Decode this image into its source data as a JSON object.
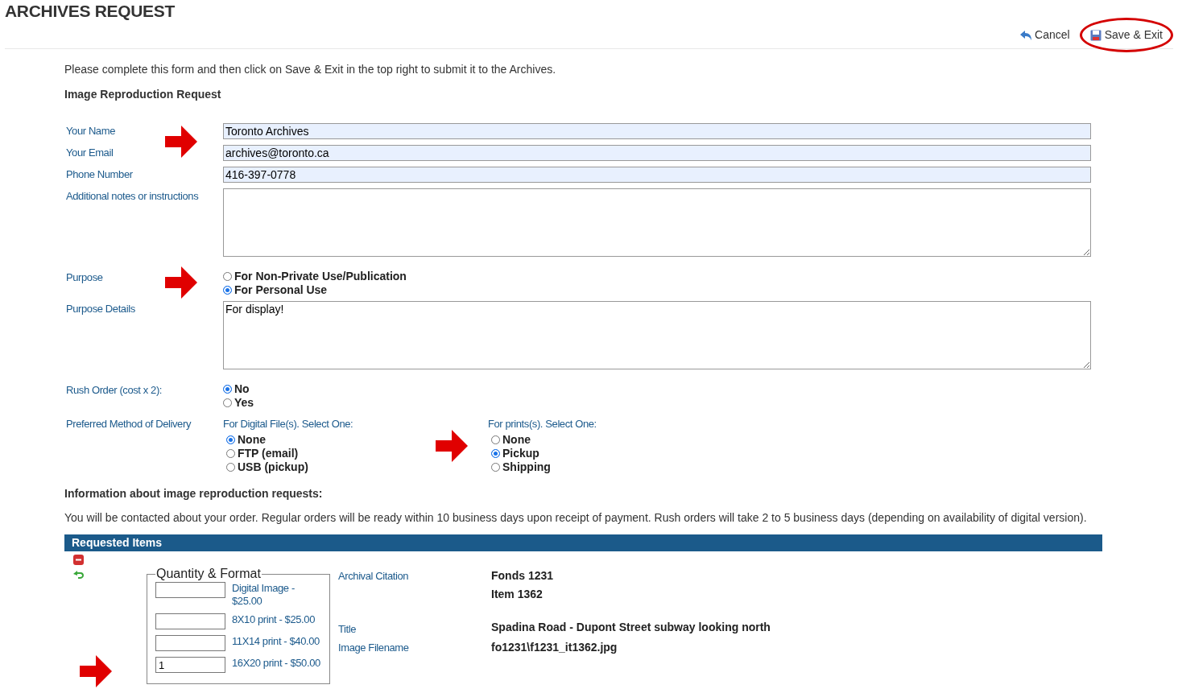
{
  "title": "ARCHIVES REQUEST",
  "toolbar": [
    {
      "kind": "cancel",
      "label": "Cancel",
      "circled": false
    },
    {
      "kind": "save",
      "label": "Save & Exit",
      "circled": true
    }
  ],
  "intro": "Please complete this form and then click on Save & Exit in the top right to submit it to the Archives.",
  "section_title": "Image Reproduction Request",
  "fields": [
    {
      "kind": "text",
      "label": "Your Name",
      "value": "Toronto Archives",
      "arrow": true
    },
    {
      "kind": "text",
      "label": "Your Email",
      "value": "archives@toronto.ca",
      "arrow": false
    },
    {
      "kind": "text",
      "label": "Phone Number",
      "value": "416-397-0778",
      "arrow": false
    },
    {
      "kind": "textarea",
      "label": "Additional notes or instructions",
      "arrow": false
    },
    {
      "kind": "radio",
      "label": "Purpose",
      "arrow": true,
      "options": [
        {
          "label": "For Non-Private Use/Publication",
          "selected": false
        },
        {
          "label": "For Personal Use",
          "selected": true
        }
      ]
    },
    {
      "kind": "textarea",
      "label": "Purpose Details",
      "value": "For display!",
      "arrow": false
    },
    {
      "kind": "radio",
      "label": "Rush Order (cost x 2):",
      "arrow": false,
      "options": [
        {
          "label": "No",
          "selected": true
        },
        {
          "label": "Yes",
          "selected": false
        }
      ]
    },
    {
      "kind": "delivery",
      "label": "Preferred Method of Delivery",
      "arrow": false,
      "groups": [
        {
          "title": "For Digital File(s). Select One:",
          "arrow": false,
          "options": [
            {
              "label": "None",
              "selected": true
            },
            {
              "label": "FTP (email)",
              "selected": false
            },
            {
              "label": "USB (pickup)",
              "selected": false
            }
          ]
        },
        {
          "title": "For prints(s). Select One:",
          "arrow": true,
          "options": [
            {
              "label": "None",
              "selected": false
            },
            {
              "label": "Pickup",
              "selected": true
            },
            {
              "label": "Shipping",
              "selected": false
            }
          ]
        }
      ]
    }
  ],
  "info_title": "Information about image reproduction requests:",
  "info_text": "You will be contacted about your order. Regular orders will be ready within 10 business days upon receipt of payment. Rush orders will take 2 to 5 business days (depending on availability of digital version).",
  "items_bar": "Requested Items",
  "item": {
    "legend": "Quantity & Format",
    "formats": [
      {
        "label": "Digital Image - $25.00",
        "arrow": false
      },
      {
        "label": "8X10 print - $25.00",
        "arrow": false
      },
      {
        "label": "11X14 print - $40.00",
        "arrow": false
      },
      {
        "label": "16X20 print - $50.00",
        "value": "1",
        "arrow": true
      }
    ],
    "details": [
      {
        "label": "Archival Citation",
        "values": [
          "Fonds 1231",
          "Item 1362"
        ]
      },
      {
        "label": "Title",
        "values": [
          "Spadina Road - Dupont Street subway looking north"
        ]
      },
      {
        "label": "Image Filename",
        "values": [
          "fo1231\\f1231_it1362.jpg"
        ]
      }
    ]
  }
}
